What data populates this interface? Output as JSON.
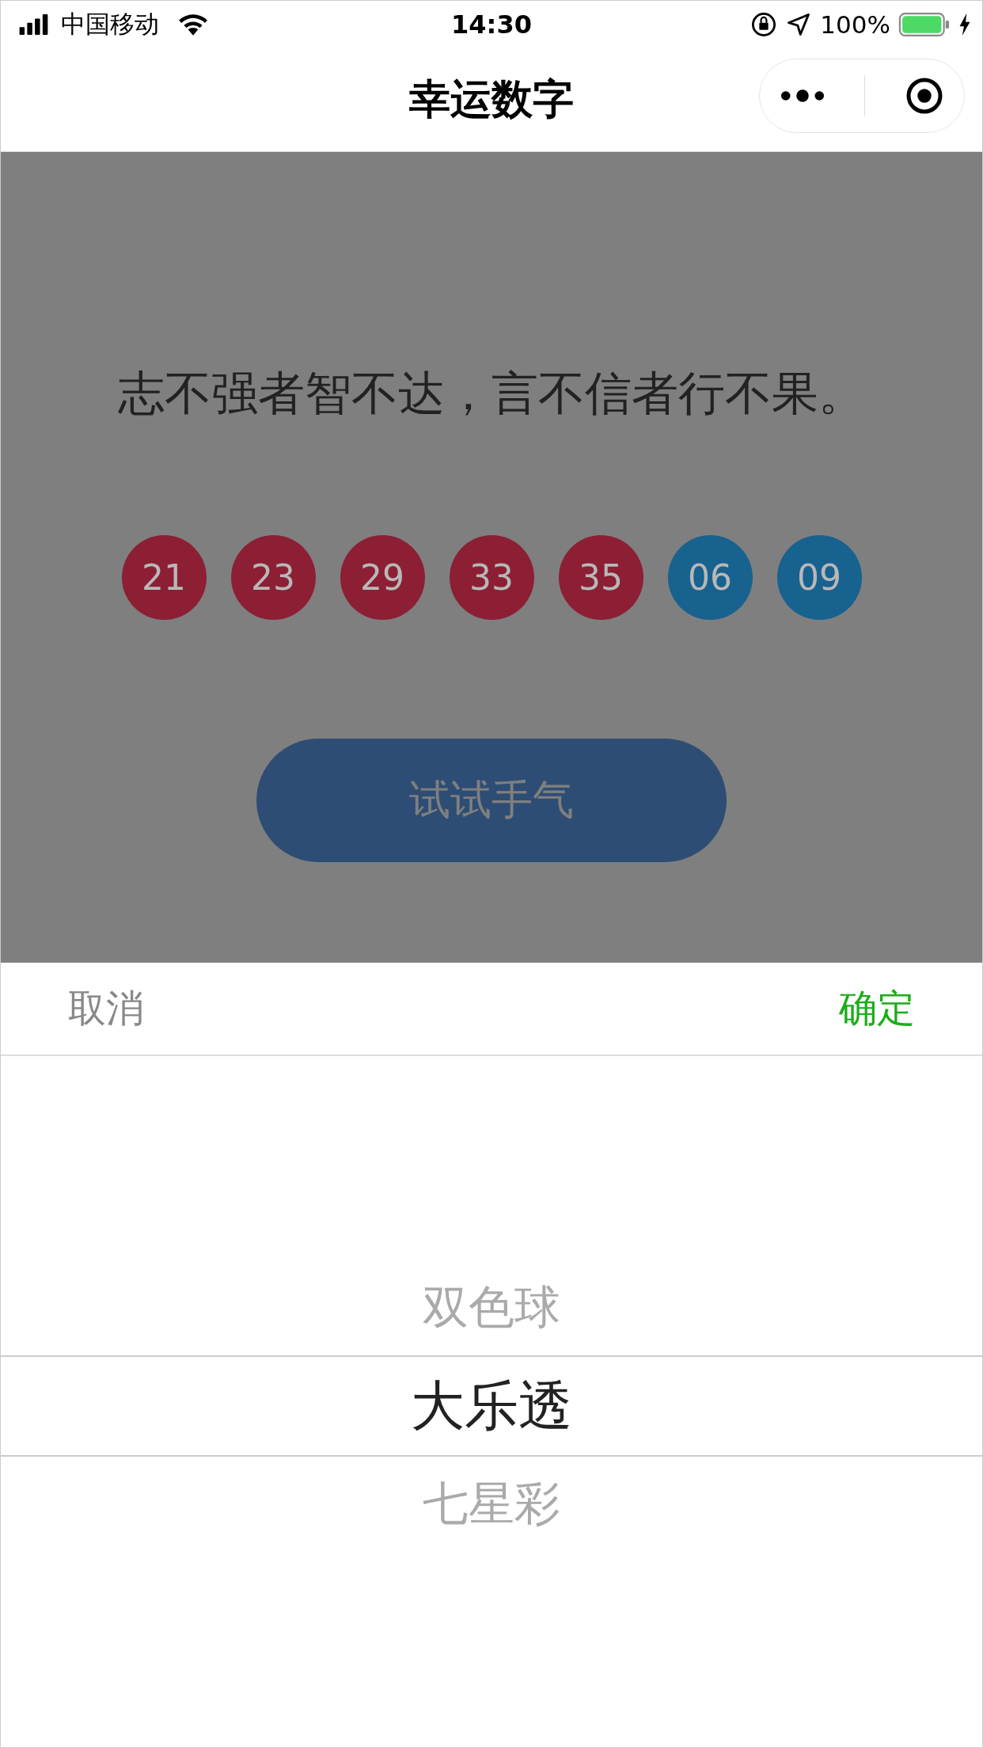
{
  "status_bar": {
    "carrier": "中国移动",
    "time": "14:30",
    "battery": "100%"
  },
  "nav": {
    "title": "幸运数字"
  },
  "quote": "志不强者智不达，言不信者行不果。",
  "balls": [
    {
      "number": "21",
      "color": "#8c1f34"
    },
    {
      "number": "23",
      "color": "#8c1f34"
    },
    {
      "number": "29",
      "color": "#8c1f34"
    },
    {
      "number": "33",
      "color": "#8c1f34"
    },
    {
      "number": "35",
      "color": "#8c1f34"
    },
    {
      "number": "06",
      "color": "#17628f"
    },
    {
      "number": "09",
      "color": "#17628f"
    }
  ],
  "button": {
    "label": "试试手气"
  },
  "picker": {
    "cancel": "取消",
    "confirm": "确定",
    "options": [
      {
        "label": "双色球",
        "selected": false
      },
      {
        "label": "大乐透",
        "selected": true
      },
      {
        "label": "七星彩",
        "selected": false
      }
    ]
  }
}
